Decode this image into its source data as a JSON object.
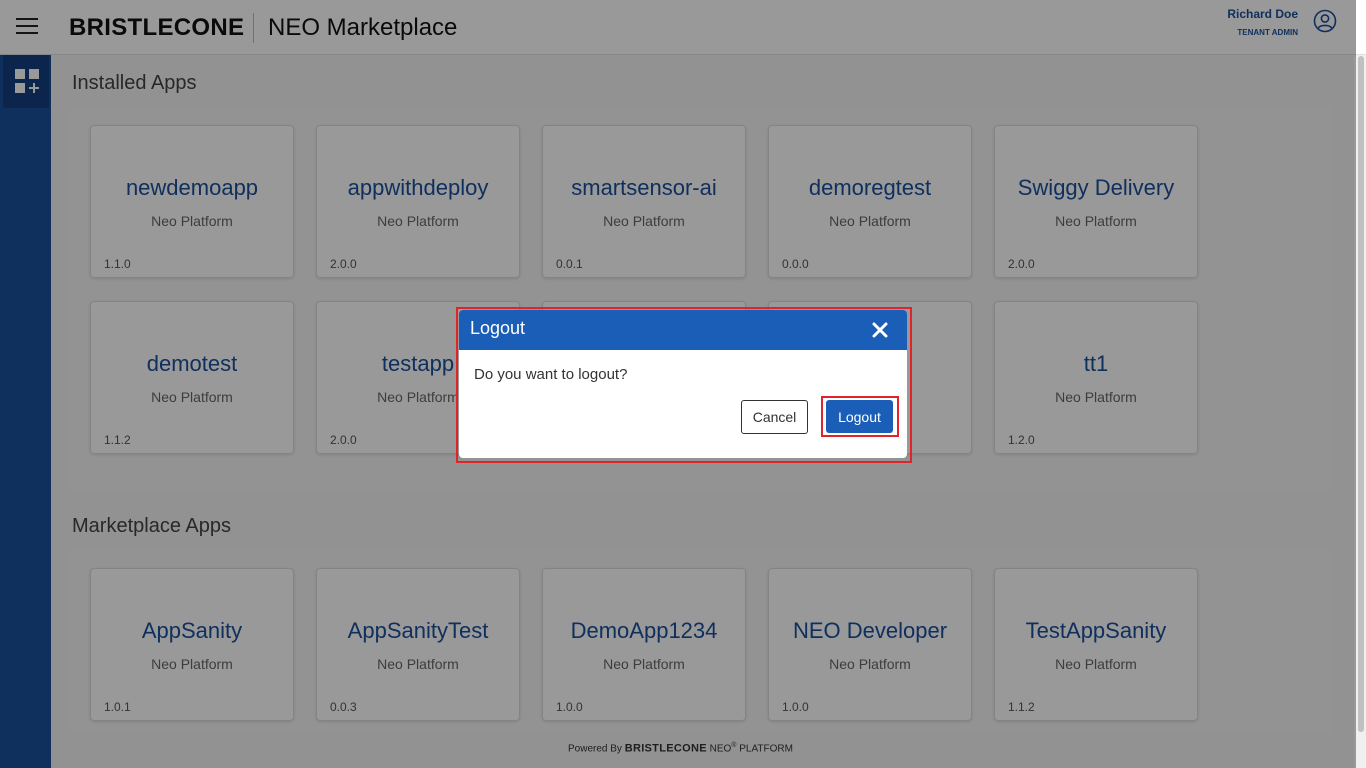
{
  "header": {
    "brand": "BRISTLECONE",
    "title": "NEO Marketplace",
    "user_name": "Richard Doe",
    "user_role": "TENANT ADMIN"
  },
  "installed": {
    "title": "Installed Apps",
    "apps": [
      {
        "name": "newdemoapp",
        "platform": "Neo Platform",
        "version": "1.1.0"
      },
      {
        "name": "appwithdeploy",
        "platform": "Neo Platform",
        "version": "2.0.0"
      },
      {
        "name": "smartsensor-ai",
        "platform": "Neo Platform",
        "version": "0.0.1"
      },
      {
        "name": "demoregtest",
        "platform": "Neo Platform",
        "version": "0.0.0"
      },
      {
        "name": "Swiggy Delivery",
        "platform": "Neo Platform",
        "version": "2.0.0"
      },
      {
        "name": "demotest",
        "platform": "Neo Platform",
        "version": "1.1.2"
      },
      {
        "name": "testapp",
        "platform": "Neo Platform",
        "version": "2.0.0"
      },
      {
        "name": "",
        "platform": "",
        "version": ""
      },
      {
        "name": "",
        "platform": "",
        "version": ""
      },
      {
        "name": "tt1",
        "platform": "Neo Platform",
        "version": "1.2.0"
      }
    ]
  },
  "marketplace": {
    "title": "Marketplace Apps",
    "apps": [
      {
        "name": "AppSanity",
        "platform": "Neo Platform",
        "version": "1.0.1"
      },
      {
        "name": "AppSanityTest",
        "platform": "Neo Platform",
        "version": "0.0.3"
      },
      {
        "name": "DemoApp1234",
        "platform": "Neo Platform",
        "version": "1.0.0"
      },
      {
        "name": "NEO Developer",
        "platform": "Neo Platform",
        "version": "1.0.0"
      },
      {
        "name": "TestAppSanity",
        "platform": "Neo Platform",
        "version": "1.1.2"
      }
    ]
  },
  "footer": {
    "powered_by": "Powered By",
    "brand": "BRISTLECONE",
    "neo": "NEO",
    "reg": "®",
    "platform": "PLATFORM"
  },
  "dialog": {
    "title": "Logout",
    "message": "Do you want to logout?",
    "cancel_label": "Cancel",
    "logout_label": "Logout"
  },
  "colors": {
    "brand_blue": "#1a4f9c",
    "dialog_header": "#1a5eb8",
    "highlight": "#e0242a"
  },
  "icons": {
    "menu": "hamburger-menu-icon",
    "user": "user-circle-icon",
    "apps": "apps-add-icon",
    "close": "close-icon"
  }
}
